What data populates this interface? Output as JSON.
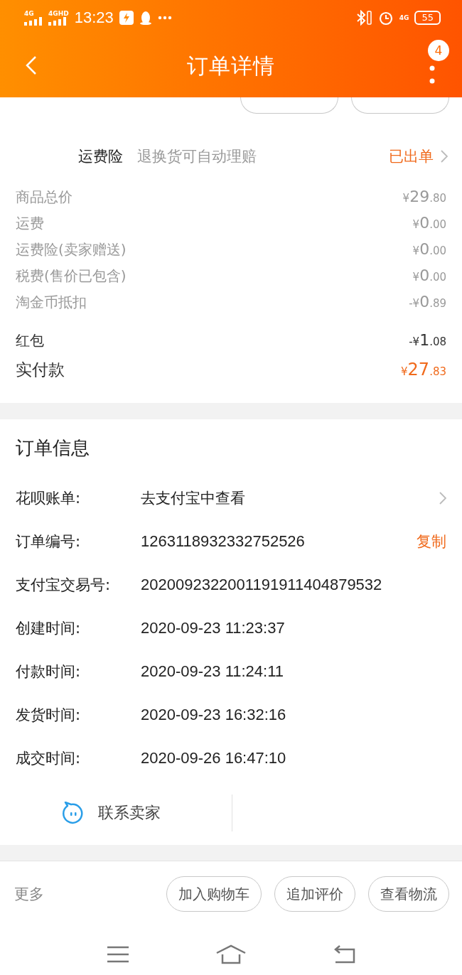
{
  "status_bar": {
    "signal_1": "4G",
    "signal_2": "4GHD",
    "time": "13:23",
    "network": "4G",
    "battery": "55"
  },
  "header": {
    "title": "订单详情",
    "badge": "4"
  },
  "insurance": {
    "name": "运费险",
    "description": "退换货可自动理赔",
    "status": "已出单"
  },
  "price_rows": [
    {
      "label": "商品总价",
      "sign": "¥",
      "integer": "29",
      "decimal": ".80",
      "kind": "fee"
    },
    {
      "label": "运费",
      "sign": "¥",
      "integer": "0",
      "decimal": ".00",
      "kind": "fee"
    },
    {
      "label": "运费险(卖家赠送)",
      "sign": "¥",
      "integer": "0",
      "decimal": ".00",
      "kind": "fee"
    },
    {
      "label": "税费(售价已包含)",
      "sign": "¥",
      "integer": "0",
      "decimal": ".00",
      "kind": "fee"
    },
    {
      "label": "淘金币抵扣",
      "sign": "-¥",
      "integer": "0",
      "decimal": ".89",
      "kind": "fee"
    },
    {
      "label": "红包",
      "sign": "-¥",
      "integer": "1",
      "decimal": ".08",
      "kind": "discount"
    },
    {
      "label": "实付款",
      "sign": "¥",
      "integer": "27",
      "decimal": ".83",
      "kind": "total"
    }
  ],
  "order_info": {
    "title": "订单信息",
    "rows": [
      {
        "label": "花呗账单:",
        "value": "去支付宝中查看",
        "kind": "link"
      },
      {
        "label": "订单编号:",
        "value": "1263118932332752526",
        "action": "复制",
        "kind": "copy"
      },
      {
        "label": "支付宝交易号:",
        "value": "2020092322001191911404879532",
        "kind": "plain"
      },
      {
        "label": "创建时间:",
        "value": "2020-09-23 11:23:37",
        "kind": "plain"
      },
      {
        "label": "付款时间:",
        "value": "2020-09-23 11:24:11",
        "kind": "plain"
      },
      {
        "label": "发货时间:",
        "value": "2020-09-23 16:32:16",
        "kind": "plain"
      },
      {
        "label": "成交时间:",
        "value": "2020-09-26 16:47:10",
        "kind": "plain"
      }
    ]
  },
  "contact": "联系卖家",
  "bottom_bar": {
    "more": "更多",
    "buttons": [
      "加入购物车",
      "追加评价",
      "查看物流"
    ]
  }
}
